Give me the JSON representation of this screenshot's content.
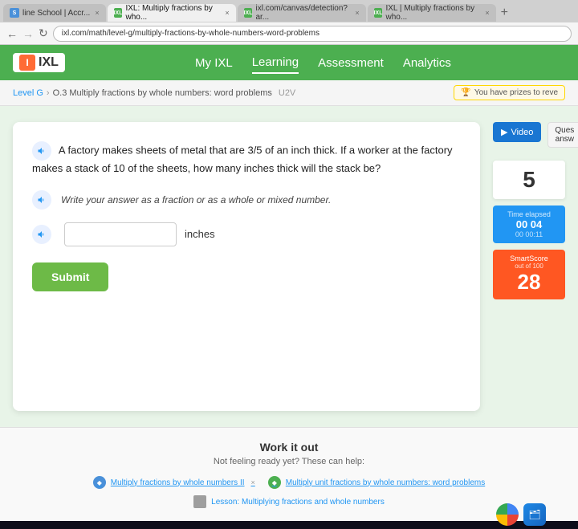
{
  "browser": {
    "tabs": [
      {
        "id": "tab1",
        "label": "line School | Accr...",
        "favicon": "S",
        "active": false
      },
      {
        "id": "tab2",
        "label": "IXL: Multiply fractions by who...",
        "favicon": "IXL",
        "active": false
      },
      {
        "id": "tab3",
        "label": "ixl.com/canvas/detection?ar...",
        "favicon": "IXL",
        "active": false
      },
      {
        "id": "tab4",
        "label": "IXL | Multiply fractions by who...",
        "favicon": "IXL",
        "active": true
      }
    ],
    "address": "ixl.com/math/level-g/multiply-fractions-by-whole-numbers-word-problems",
    "add_tab": "+"
  },
  "ixl": {
    "logo_text": "IXL",
    "nav": {
      "my_ixl": "My IXL",
      "learning": "Learning",
      "assessment": "Assessment",
      "analytics": "Analytics"
    },
    "breadcrumb": {
      "level": "Level G",
      "separator": ">",
      "topic": "O.3 Multiply fractions by whole numbers: word problems",
      "code": "U2V"
    },
    "prize_banner": "You have prizes to reve",
    "question": {
      "text1": "A factory makes sheets of metal that are 3/5 of an inch thick. If a worker at the factory makes a stack of 10 of the sheets, how many inches thick will the stack be?",
      "text2": "Write your answer as a fraction or as a whole or mixed number.",
      "input_placeholder": "",
      "unit": "inches",
      "submit_label": "Submit"
    },
    "side_panel": {
      "video_label": "Video",
      "question_label": "Ques",
      "answer_label": "answ",
      "count": "5",
      "timer_label": "Time elapsed",
      "timer_value": "00 04",
      "timer_detail": "00  00:11",
      "smart_score_label": "SmartScore",
      "smart_score_sub": "out of 100",
      "smart_score_value": "28"
    },
    "work_it_out": {
      "title": "Work it out",
      "subtitle": "Not feeling ready yet? These can help:",
      "links": [
        {
          "text": "Multiply fractions by whole numbers II",
          "type": "blue"
        },
        {
          "text": "Multiply unit fractions by whole numbers: word problems",
          "type": "green"
        }
      ],
      "lesson": "Lesson: Multiplying fractions and whole numbers"
    }
  }
}
